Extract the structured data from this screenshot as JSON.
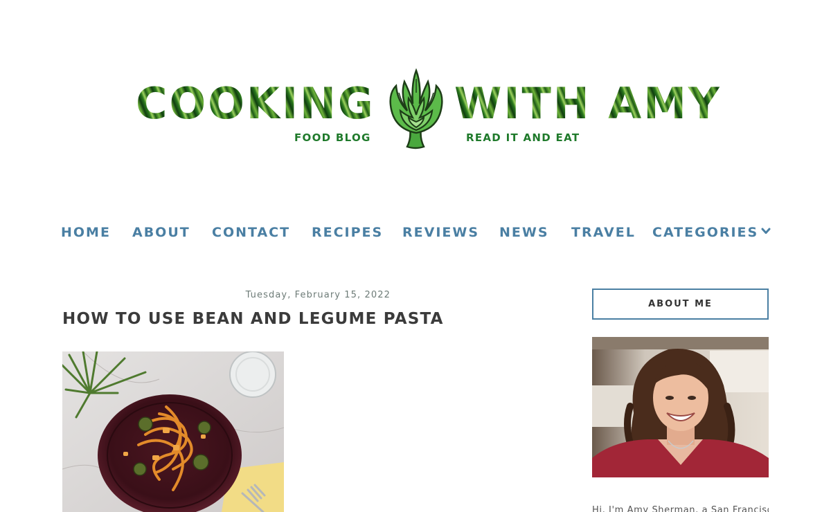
{
  "blog": {
    "title_left": "COOKING",
    "title_right": "WITH AMY",
    "tagline_left": "FOOD BLOG",
    "tagline_right": "READ IT AND EAT"
  },
  "nav": {
    "items": [
      {
        "label": "HOME"
      },
      {
        "label": "ABOUT"
      },
      {
        "label": "CONTACT"
      },
      {
        "label": "RECIPES"
      },
      {
        "label": "REVIEWS"
      },
      {
        "label": "NEWS"
      },
      {
        "label": "TRAVEL"
      },
      {
        "label": "CATEGORIES"
      }
    ]
  },
  "post": {
    "date": "Tuesday, February 15, 2022",
    "title": "HOW TO USE BEAN AND LEGUME PASTA"
  },
  "sidebar": {
    "heading": "ABOUT ME",
    "bio_start": "Hi, I'm Amy Sherman, a San Francisco"
  },
  "colors": {
    "nav": "#4a7fa3",
    "logo_green": "#1f7a2b",
    "title": "#3b3b3b"
  }
}
